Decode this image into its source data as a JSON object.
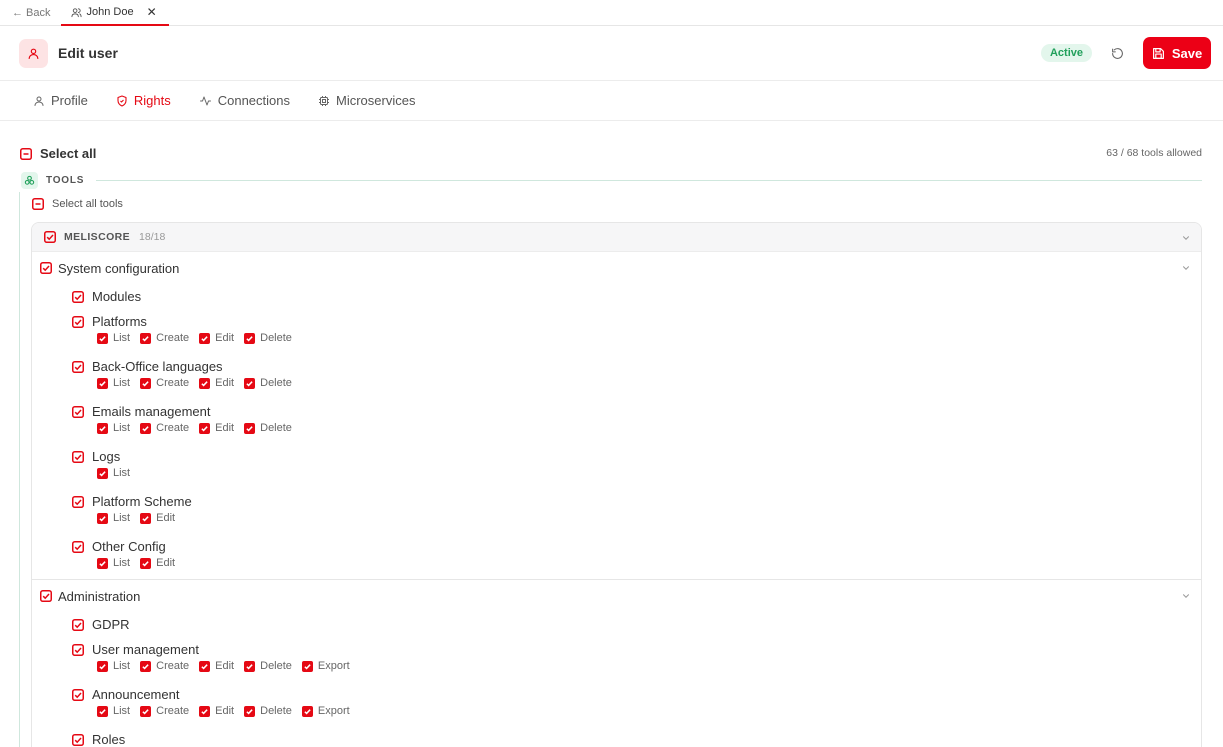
{
  "tabbar": {
    "back_label": "← Back",
    "doc_tab_label": "John Doe",
    "close_glyph": "✕"
  },
  "header": {
    "title": "Edit user",
    "status_badge": "Active",
    "save_label": "Save",
    "accent_color": "#e50914"
  },
  "subtabs": [
    {
      "label": "Profile",
      "icon": "user-icon",
      "active": false
    },
    {
      "label": "Rights",
      "icon": "shield-icon",
      "active": true
    },
    {
      "label": "Connections",
      "icon": "activity-icon",
      "active": false
    },
    {
      "label": "Microservices",
      "icon": "chip-icon",
      "active": false
    }
  ],
  "rights": {
    "select_all_label": "Select all",
    "counter": "63 / 68 tools allowed",
    "tools_label": "TOOLS",
    "select_all_tools_label": "Select all tools",
    "module": {
      "name": "MELISCORE",
      "count": "18/18",
      "groups": [
        {
          "label": "System configuration",
          "items": [
            {
              "label": "Modules",
              "perms": []
            },
            {
              "label": "Platforms",
              "perms": [
                "List",
                "Create",
                "Edit",
                "Delete"
              ]
            },
            {
              "label": "Back-Office languages",
              "perms": [
                "List",
                "Create",
                "Edit",
                "Delete"
              ]
            },
            {
              "label": "Emails management",
              "perms": [
                "List",
                "Create",
                "Edit",
                "Delete"
              ]
            },
            {
              "label": "Logs",
              "perms": [
                "List"
              ]
            },
            {
              "label": "Platform Scheme",
              "perms": [
                "List",
                "Edit"
              ]
            },
            {
              "label": "Other Config",
              "perms": [
                "List",
                "Edit"
              ]
            }
          ]
        },
        {
          "label": "Administration",
          "items": [
            {
              "label": "GDPR",
              "perms": []
            },
            {
              "label": "User management",
              "perms": [
                "List",
                "Create",
                "Edit",
                "Delete",
                "Export"
              ]
            },
            {
              "label": "Announcement",
              "perms": [
                "List",
                "Create",
                "Edit",
                "Delete",
                "Export"
              ]
            },
            {
              "label": "Roles",
              "perms": []
            }
          ]
        }
      ]
    }
  }
}
